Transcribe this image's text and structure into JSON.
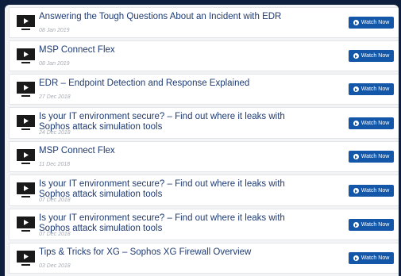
{
  "webinars": [
    {
      "title": "Answering the Tough Questions About an Incident with EDR",
      "date": "08 Jan 2019",
      "button": "Watch Now"
    },
    {
      "title": "MSP Connect Flex",
      "date": "08 Jan 2019",
      "button": "Watch Now"
    },
    {
      "title": "EDR – Endpoint Detection and Response Explained",
      "date": "27 Dec 2018",
      "button": "Watch Now"
    },
    {
      "title": "Is your IT environment secure? – Find out where it leaks with Sophos attack simulation tools",
      "date": "24 Dec 2018",
      "button": "Watch Now"
    },
    {
      "title": "MSP Connect Flex",
      "date": "11 Dec 2018",
      "button": "Watch Now"
    },
    {
      "title": "Is your IT environment secure? – Find out where it leaks with Sophos attack simulation tools",
      "date": "07 Dec 2018",
      "button": "Watch Now"
    },
    {
      "title": "Is your IT environment secure? – Find out where it leaks with Sophos attack simulation tools",
      "date": "07 Dec 2018",
      "button": "Watch Now"
    },
    {
      "title": "Tips & Tricks for XG – Sophos XG Firewall Overview",
      "date": "03 Dec 2018",
      "button": "Watch Now"
    }
  ]
}
